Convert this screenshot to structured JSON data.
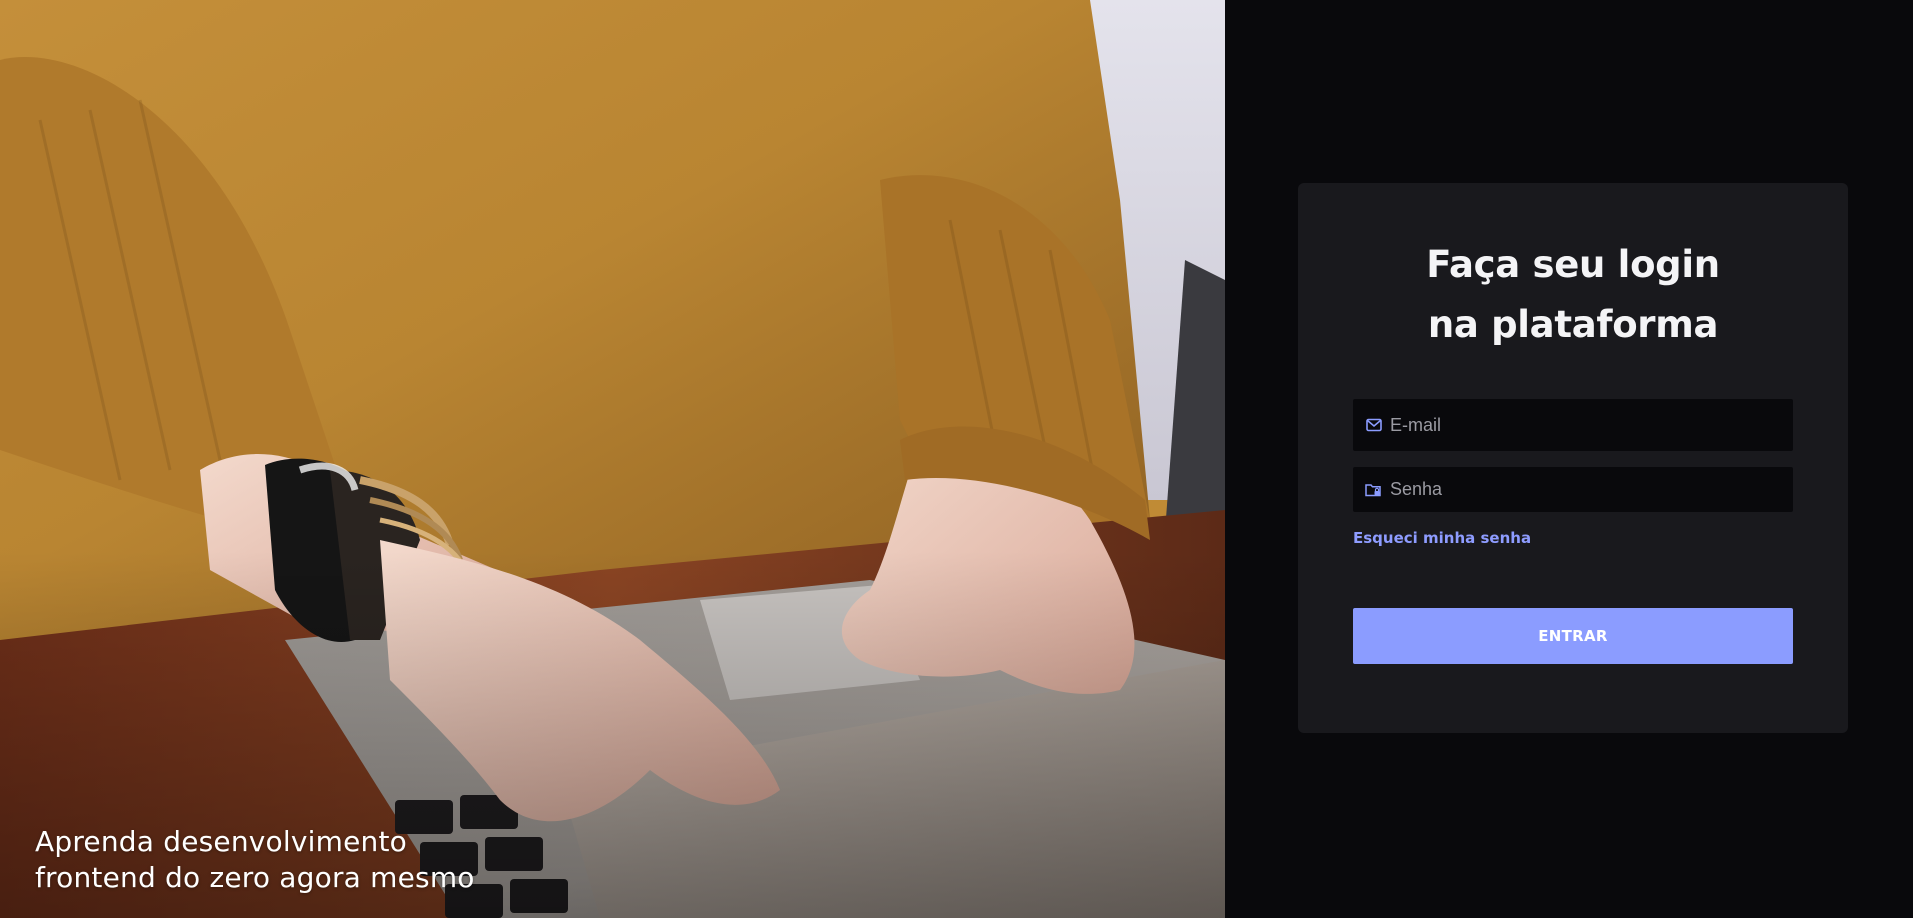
{
  "hero": {
    "caption_line1": "Aprenda desenvolvimento",
    "caption_line2": "frontend do zero agora mesmo",
    "photo_subject": "person in mustard sweater typing on laptop"
  },
  "login": {
    "title_line1": "Faça seu login",
    "title_line2": "na plataforma",
    "email_placeholder": "E-mail",
    "password_placeholder": "Senha",
    "forgot_label": "Esqueci minha senha",
    "submit_label": "ENTRAR"
  },
  "icons": {
    "email": "mail-icon",
    "password": "folder-lock-icon"
  },
  "colors": {
    "page_bg": "#09090c",
    "card_bg": "#19191d",
    "input_bg": "#09090c",
    "accent": "#8b9cff",
    "title_text": "#f4f4f6",
    "placeholder_text": "#9b9ba3"
  }
}
